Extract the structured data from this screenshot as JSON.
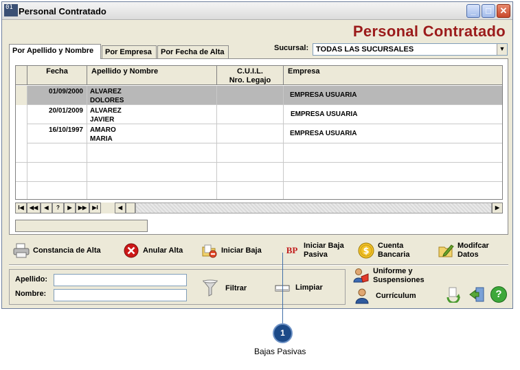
{
  "window": {
    "title": "Personal Contratado",
    "icon_text": "01",
    "buttons": {
      "minimize": "_",
      "maximize": "□",
      "close": "✕"
    }
  },
  "header": {
    "title": "Personal Contratado"
  },
  "tabs": [
    {
      "label": "Por Apellido y Nombre",
      "active": true
    },
    {
      "label": "Por Empresa",
      "active": false
    },
    {
      "label": "Por Fecha de Alta",
      "active": false
    }
  ],
  "sucursal": {
    "label": "Sucursal:",
    "value": "TODAS LAS SUCURSALES"
  },
  "grid": {
    "headers": [
      "Fecha",
      "Apellido y Nombre",
      "C.U.I.L.",
      "Nro. Legajo",
      "Empresa"
    ],
    "rows": [
      {
        "fecha": "01/09/2000",
        "apellido": "ALVAREZ",
        "nombre": "DOLORES",
        "empresa": "EMPRESA USUARIA",
        "selected": true
      },
      {
        "fecha": "20/01/2009",
        "apellido": "ALVAREZ",
        "nombre": "JAVIER",
        "empresa": "EMPRESA USUARIA",
        "selected": false
      },
      {
        "fecha": "16/10/1997",
        "apellido": "AMARO",
        "nombre": "MARIA",
        "empresa": "EMPRESA USUARIA",
        "selected": false
      }
    ]
  },
  "navigator": [
    "I◀",
    "◀◀",
    "◀",
    "?",
    "▶",
    "▶▶",
    "▶I",
    "◀",
    "▶"
  ],
  "actions": {
    "constancia": "Constancia de Alta",
    "anular": "Anular Alta",
    "iniciar_baja": "Iniciar Baja",
    "bp_icon": "BP",
    "baja_pasiva_1": "Iniciar Baja",
    "baja_pasiva_2": "Pasiva",
    "cuenta_1": "Cuenta",
    "cuenta_2": "Bancaria",
    "modificar_1": "Modifcar",
    "modificar_2": "Datos"
  },
  "search": {
    "apellido_label": "Apellido:",
    "nombre_label": "Nombre:",
    "filtrar": "Filtrar",
    "limpiar": "Limpiar"
  },
  "side": {
    "uniforme_1": "Uniforme y",
    "uniforme_2": "Suspensiones",
    "curriculum": "Currículum",
    "help": "?"
  },
  "callout": {
    "number": "1",
    "text": "Bajas Pasivas"
  }
}
